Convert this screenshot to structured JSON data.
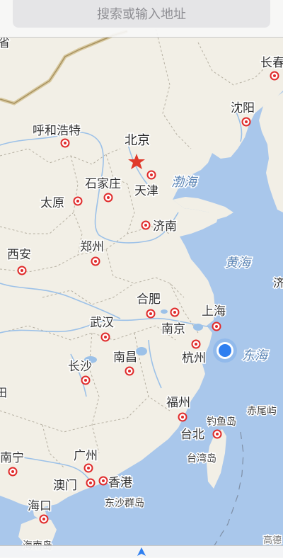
{
  "search": {
    "placeholder": "搜索或输入地址"
  },
  "colors": {
    "land": "#f2efe6",
    "sea": "#a9c7eb",
    "river": "#9cc1e8",
    "marker": "#e02b2b",
    "location": "#2f7ff0",
    "sea_label": "#5a84b5"
  },
  "capital": {
    "label": "北京",
    "icon": "red-star"
  },
  "cities": [
    {
      "name": "呼和浩特",
      "key": "hohhot"
    },
    {
      "name": "石家庄",
      "key": "shijiazhuang"
    },
    {
      "name": "天津",
      "key": "tianjin"
    },
    {
      "name": "太原",
      "key": "taiyuan"
    },
    {
      "name": "济南",
      "key": "jinan"
    },
    {
      "name": "西安",
      "key": "xian"
    },
    {
      "name": "郑州",
      "key": "zhengzhou"
    },
    {
      "name": "合肥",
      "key": "hefei"
    },
    {
      "name": "上海",
      "key": "shanghai"
    },
    {
      "name": "武汉",
      "key": "wuhan"
    },
    {
      "name": "南京",
      "key": "nanjing"
    },
    {
      "name": "杭州",
      "key": "hangzhou"
    },
    {
      "name": "南昌",
      "key": "nanchang"
    },
    {
      "name": "长沙",
      "key": "changsha"
    },
    {
      "name": "福州",
      "key": "fuzhou"
    },
    {
      "name": "台北",
      "key": "taipei"
    },
    {
      "name": "南宁",
      "key": "nanning"
    },
    {
      "name": "广州",
      "key": "guangzhou"
    },
    {
      "name": "澳门",
      "key": "macau"
    },
    {
      "name": "香港",
      "key": "hongkong"
    },
    {
      "name": "海口",
      "key": "haikou"
    },
    {
      "name": "沈阳",
      "key": "shenyang"
    },
    {
      "name": "长春",
      "key": "changchun"
    }
  ],
  "sea_labels": [
    {
      "name": "渤海",
      "key": "bohai"
    },
    {
      "name": "黄海",
      "key": "yellow-sea"
    },
    {
      "name": "东海",
      "key": "east-china-sea"
    }
  ],
  "other_labels": [
    {
      "name": "台湾岛",
      "key": "taiwan-island"
    },
    {
      "name": "钓鱼岛",
      "key": "diaoyu-island"
    },
    {
      "name": "赤尾屿",
      "key": "chiwei-island"
    },
    {
      "name": "东沙群岛",
      "key": "dongsha-islands"
    },
    {
      "name": "海南岛",
      "key": "hainan-island"
    },
    {
      "name": "济",
      "key": "cut-label-ji"
    },
    {
      "name": "高德",
      "key": "autonavi-attribution"
    },
    {
      "name": "省",
      "key": "cut-label-sheng"
    },
    {
      "name": "田",
      "key": "cut-label-tian"
    }
  ],
  "current_location": {
    "label": "当前位置"
  }
}
